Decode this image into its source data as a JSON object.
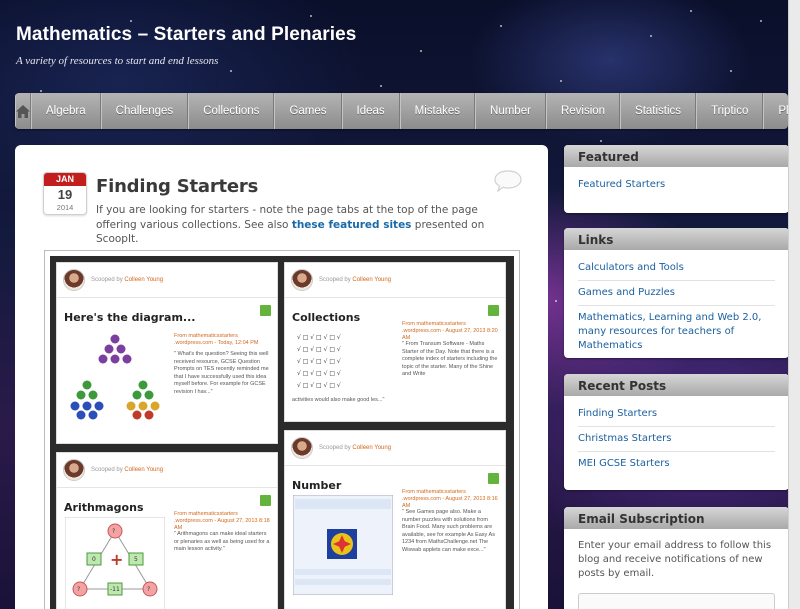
{
  "site": {
    "title": "Mathematics – Starters and Plenaries",
    "description": "A variety of resources to start and end lessons"
  },
  "nav": {
    "items": [
      "Algebra",
      "Challenges",
      "Collections",
      "Games",
      "Ideas",
      "Mistakes",
      "Number",
      "Revision",
      "Statistics",
      "Triptico",
      "Plenaries"
    ]
  },
  "post": {
    "date": {
      "month": "JAN",
      "day": "19",
      "year": "2014"
    },
    "title": "Finding Starters",
    "text_before": "If you are looking for starters - note the page tabs at the top of the page offering various collections. See also ",
    "link": "these featured sites",
    "text_after": " presented on ScoopIt."
  },
  "scoops": [
    {
      "scooped_prefix": "Scooped by ",
      "scooped_by": "Colleen Young",
      "title": "Here's the diagram...",
      "source_prefix": "From ",
      "source": "mathematicsstarters .wordpress.com",
      "date": " - Today, 12:04 PM",
      "desc": "\" What's the question? Seeing this well received resource, GCSE Question Prompts on TES recently reminded me that I have successfully used this idea myself before. For example for GCSE revision I hav...\""
    },
    {
      "scooped_prefix": "Scooped by ",
      "scooped_by": "Colleen Young",
      "title": "Collections",
      "source_prefix": "From ",
      "source": "mathematicsstarters .wordpress.com",
      "date": " - August 27, 2013 8:20 AM",
      "desc": "\" From Transum Software - Maths Starter of the Day. Note that there is a complete index of starters including the topic of the starter. Many of the Shine and Write",
      "foot": "activities would also make good les...\""
    },
    {
      "scooped_prefix": "Scooped by ",
      "scooped_by": "Colleen Young",
      "title": "Arithmagons",
      "source_prefix": "From ",
      "source": "mathematicsstarters .wordpress.com",
      "date": " - August 27, 2013 8:18 AM",
      "desc": "\" Arithmagons can make ideal starters or plenaries as well as being used for a main lesson activity.\""
    },
    {
      "scooped_prefix": "Scooped by ",
      "scooped_by": "Colleen Young",
      "title": "Number",
      "source_prefix": "From ",
      "source": "mathematicsstarters .wordpress.com",
      "date": " - August 27, 2013 8:16 AM",
      "desc": "\" See Games page also. Make a number puzzles with solutions from Brain Food. Many such problems are available, see for example As Easy As 1234 from MathsChallenge.net The Wiswab applets can make exce...\""
    }
  ],
  "sidebar": {
    "featured": {
      "title": "Featured",
      "links": [
        "Featured Starters"
      ]
    },
    "links": {
      "title": "Links",
      "links": [
        "Calculators and Tools",
        "Games and Puzzles",
        "Mathematics, Learning and Web 2.0, many resources for teachers of Mathematics"
      ]
    },
    "recent": {
      "title": "Recent Posts",
      "links": [
        "Finding Starters",
        "Christmas Starters",
        "MEI GCSE Starters"
      ]
    },
    "email": {
      "title": "Email Subscription",
      "text": "Enter your email address to follow this blog and receive notifications of new posts by email."
    }
  },
  "colors": {
    "nav": "#9c9c9c",
    "link": "#1a5f9e",
    "badge_red": "#c21e1e",
    "scoop_green": "#63b33c"
  }
}
